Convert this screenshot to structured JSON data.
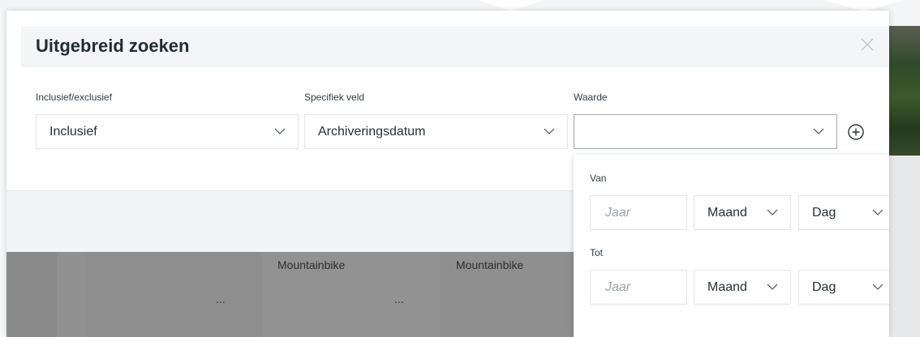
{
  "modal": {
    "title": "Uitgebreid zoeken",
    "close_icon": "close-icon"
  },
  "filters": {
    "inclusive": {
      "label": "Inclusief/exclusief",
      "value": "Inclusief"
    },
    "field": {
      "label": "Specifiek veld",
      "value": "Archiveringsdatum"
    },
    "value": {
      "label": "Waarde",
      "value": ""
    },
    "add_icon": "plus-circle-icon"
  },
  "date_panel": {
    "from": {
      "label": "Van",
      "year_placeholder": "Jaar",
      "month": "Maand",
      "day": "Dag"
    },
    "to": {
      "label": "Tot",
      "year_placeholder": "Jaar",
      "month": "Maand",
      "day": "Dag"
    }
  },
  "products": [
    {
      "title": "",
      "ellipsis": "..."
    },
    {
      "title": "Mountainbike",
      "ellipsis": "..."
    },
    {
      "title": "Mountainbike",
      "ellipsis": ""
    }
  ],
  "colors": {
    "accent": "#1f2d35",
    "overlay": "#8e8e8e",
    "border": "#e1e4e7"
  }
}
